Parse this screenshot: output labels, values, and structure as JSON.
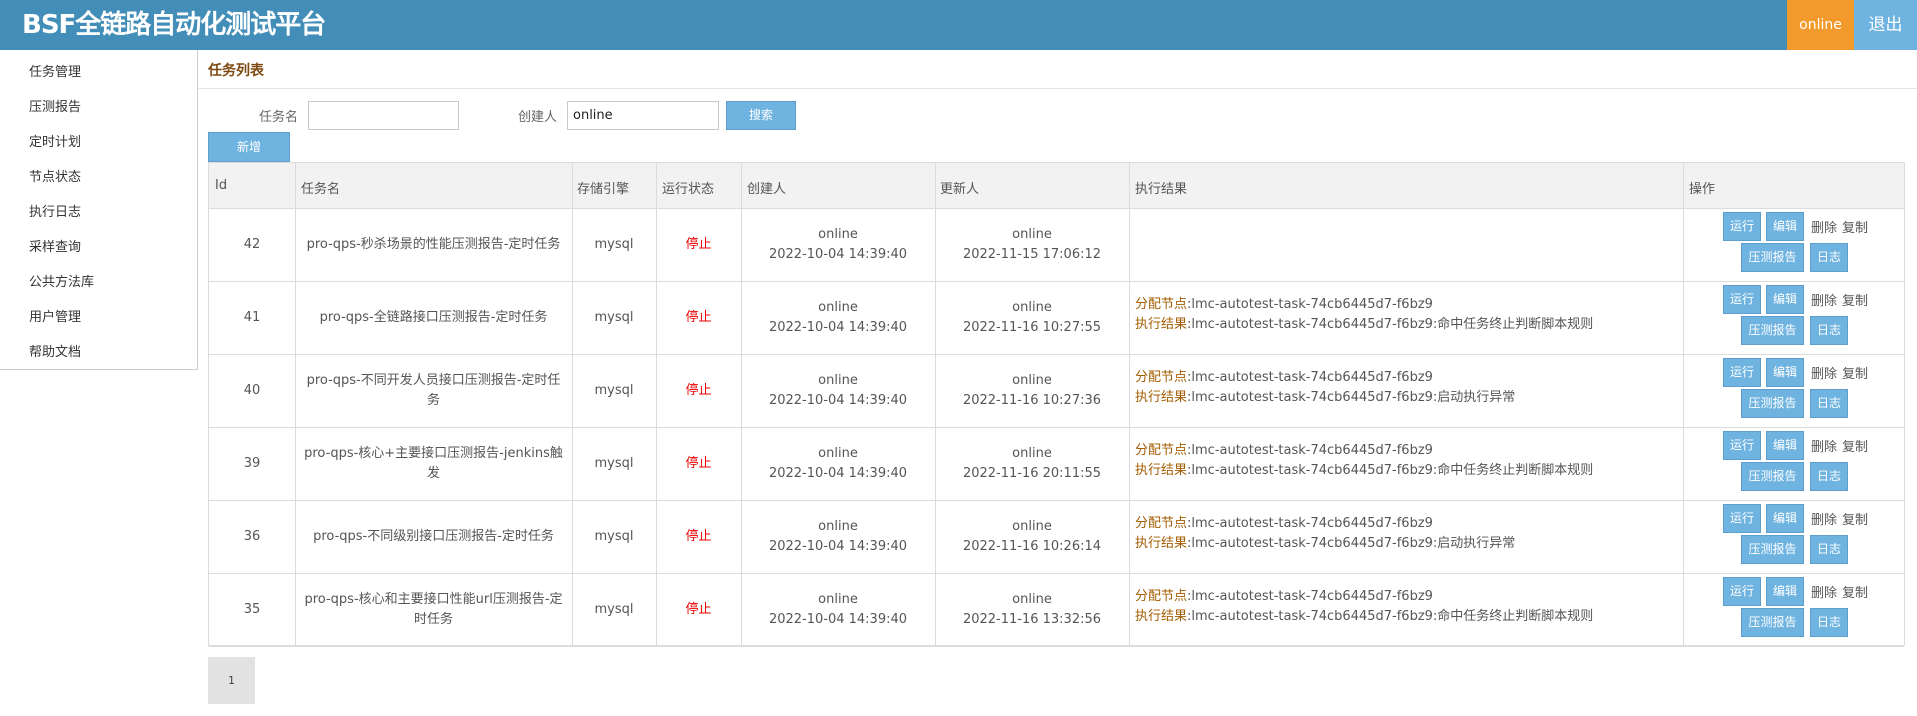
{
  "header": {
    "brand": "BSF全链路自动化测试平台",
    "user": "online",
    "logout": "退出"
  },
  "sidebar": {
    "items": [
      "任务管理",
      "压测报告",
      "定时计划",
      "节点状态",
      "执行日志",
      "采样查询",
      "公共方法库",
      "用户管理",
      "帮助文档"
    ]
  },
  "page": {
    "title": "任务列表"
  },
  "search": {
    "task_label": "任务名",
    "task_value": "",
    "creator_label": "创建人",
    "creator_value": "online",
    "search_btn": "搜索",
    "add_btn": "新增"
  },
  "table": {
    "headers": [
      "Id",
      "任务名",
      "存储引擎",
      "运行状态",
      "创建人",
      "更新人",
      "执行结果",
      "操作"
    ],
    "actions": {
      "run": "运行",
      "edit": "编辑",
      "delete": "删除",
      "copy": "复制",
      "report": "压测报告",
      "log": "日志"
    },
    "rows": [
      {
        "id": "42",
        "name": "pro-qps-秒杀场景的性能压测报告-定时任务",
        "engine": "mysql",
        "status": "停止",
        "creator": "online",
        "created": "2022-10-04 14:39:40",
        "updater": "online",
        "updated": "2022-11-15 17:06:12",
        "node_key": "",
        "node_val": "",
        "res_key": "",
        "res_val": ""
      },
      {
        "id": "41",
        "name": "pro-qps-全链路接口压测报告-定时任务",
        "engine": "mysql",
        "status": "停止",
        "creator": "online",
        "created": "2022-10-04 14:39:40",
        "updater": "online",
        "updated": "2022-11-16 10:27:55",
        "node_key": "分配节点",
        "node_val": ":lmc-autotest-task-74cb6445d7-f6bz9",
        "res_key": "执行结果",
        "res_val": ":lmc-autotest-task-74cb6445d7-f6bz9:命中任务终止判断脚本规则"
      },
      {
        "id": "40",
        "name": "pro-qps-不同开发人员接口压测报告-定时任务",
        "engine": "mysql",
        "status": "停止",
        "creator": "online",
        "created": "2022-10-04 14:39:40",
        "updater": "online",
        "updated": "2022-11-16 10:27:36",
        "node_key": "分配节点",
        "node_val": ":lmc-autotest-task-74cb6445d7-f6bz9",
        "res_key": "执行结果",
        "res_val": ":lmc-autotest-task-74cb6445d7-f6bz9:启动执行异常"
      },
      {
        "id": "39",
        "name": "pro-qps-核心+主要接口压测报告-jenkins触发",
        "engine": "mysql",
        "status": "停止",
        "creator": "online",
        "created": "2022-10-04 14:39:40",
        "updater": "online",
        "updated": "2022-11-16 20:11:55",
        "node_key": "分配节点",
        "node_val": ":lmc-autotest-task-74cb6445d7-f6bz9",
        "res_key": "执行结果",
        "res_val": ":lmc-autotest-task-74cb6445d7-f6bz9:命中任务终止判断脚本规则"
      },
      {
        "id": "36",
        "name": "pro-qps-不同级别接口压测报告-定时任务",
        "engine": "mysql",
        "status": "停止",
        "creator": "online",
        "created": "2022-10-04 14:39:40",
        "updater": "online",
        "updated": "2022-11-16 10:26:14",
        "node_key": "分配节点",
        "node_val": ":lmc-autotest-task-74cb6445d7-f6bz9",
        "res_key": "执行结果",
        "res_val": ":lmc-autotest-task-74cb6445d7-f6bz9:启动执行异常"
      },
      {
        "id": "35",
        "name": "pro-qps-核心和主要接口性能url压测报告-定时任务",
        "engine": "mysql",
        "status": "停止",
        "creator": "online",
        "created": "2022-10-04 14:39:40",
        "updater": "online",
        "updated": "2022-11-16 13:32:56",
        "node_key": "分配节点",
        "node_val": ":lmc-autotest-task-74cb6445d7-f6bz9",
        "res_key": "执行结果",
        "res_val": ":lmc-autotest-task-74cb6445d7-f6bz9:命中任务终止判断脚本规则"
      }
    ]
  },
  "pagination": {
    "page": "1"
  }
}
